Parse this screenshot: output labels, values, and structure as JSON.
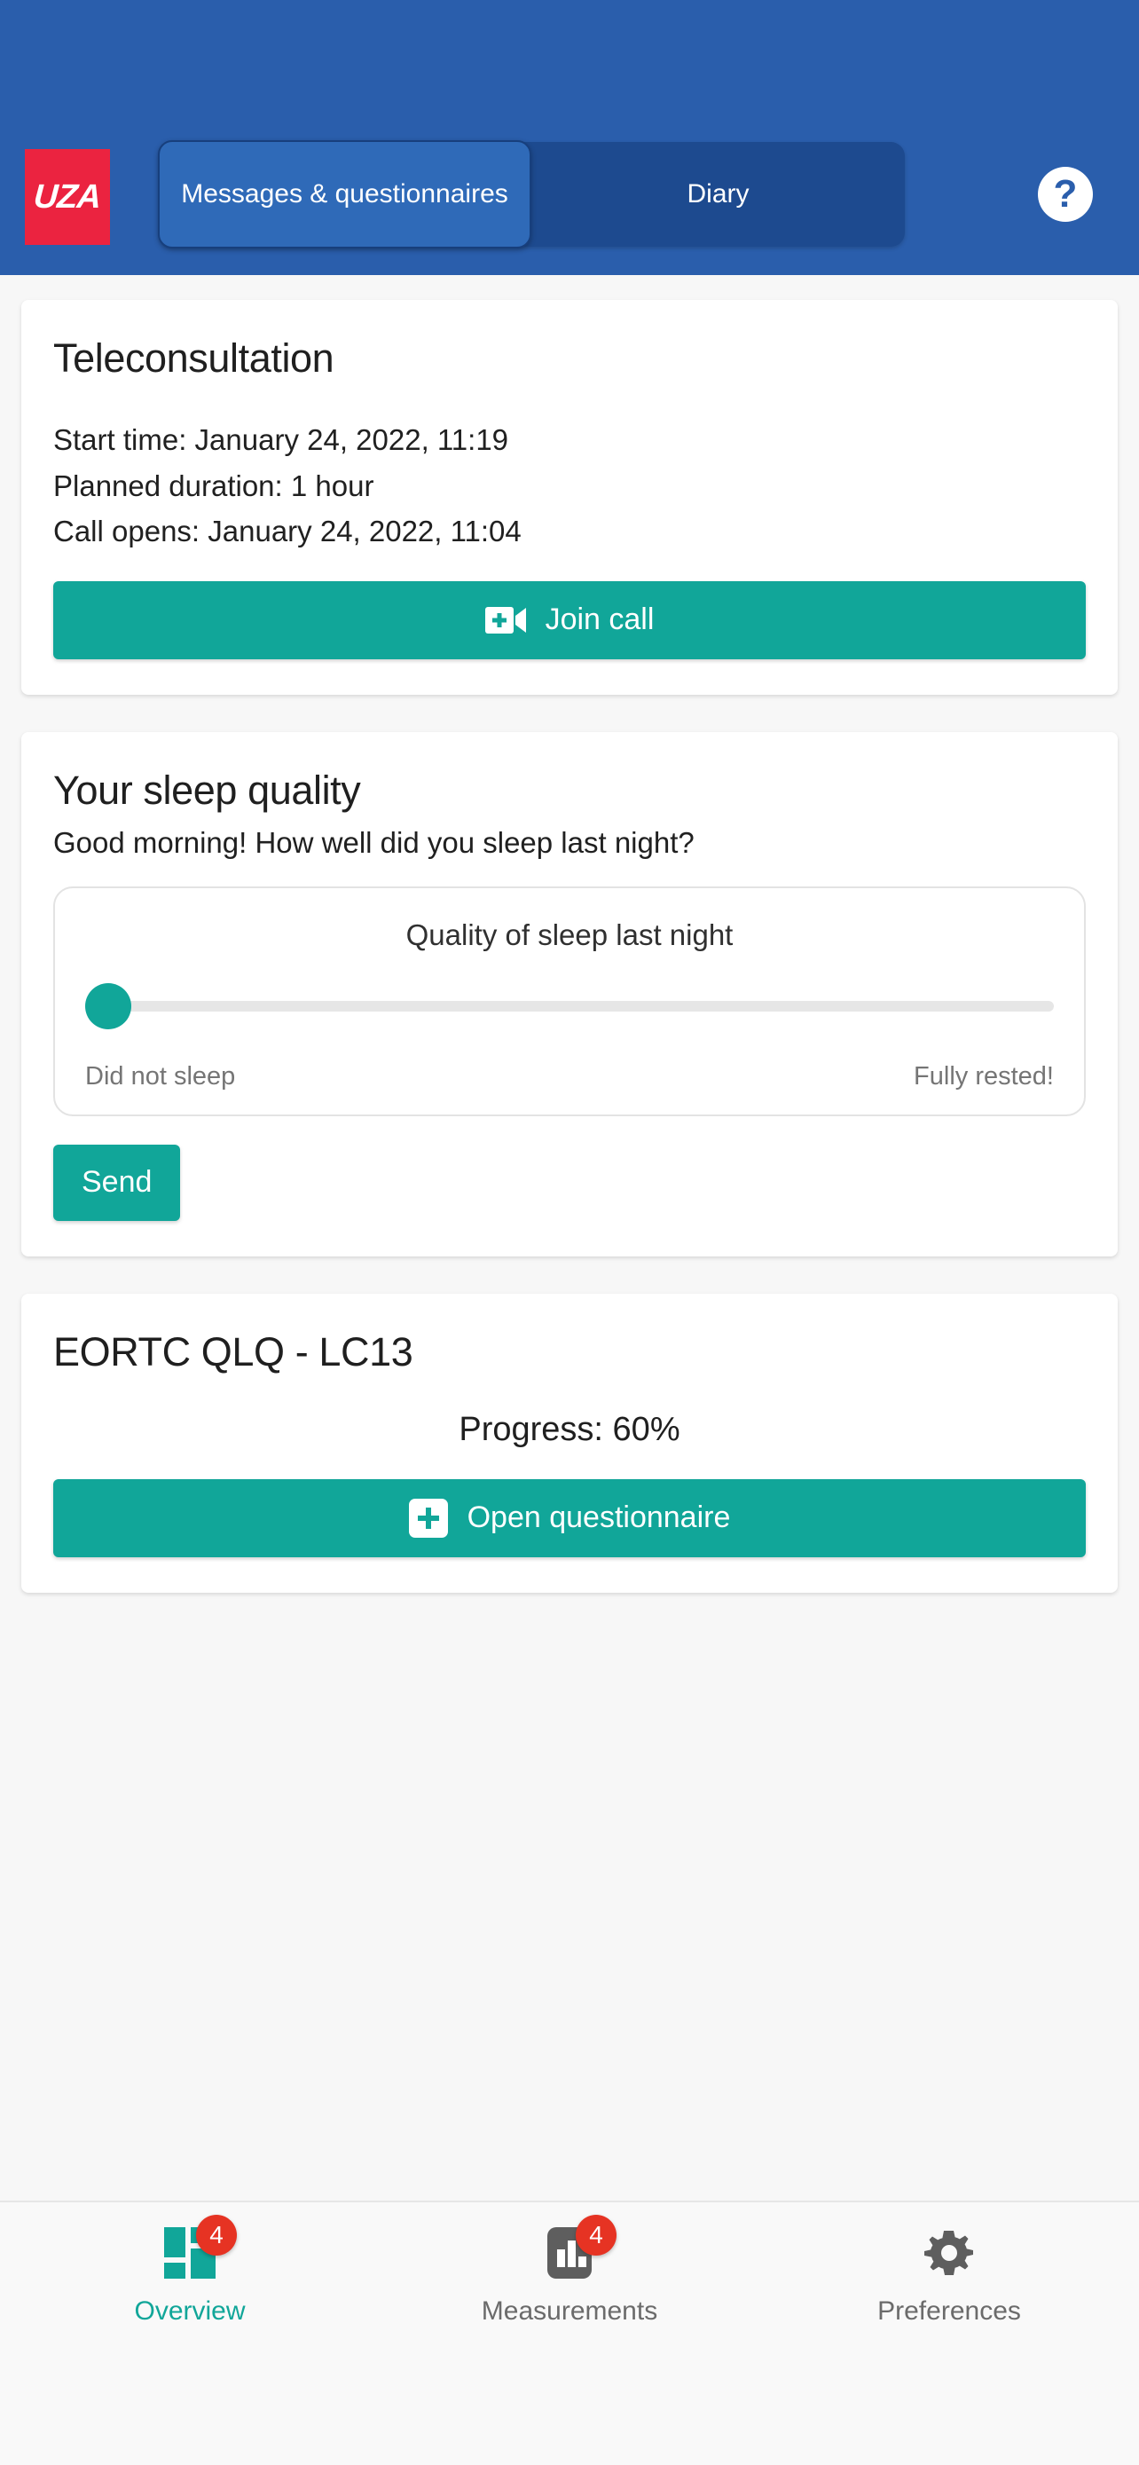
{
  "brand": {
    "logo_text": "UZA",
    "logo_bg": "#eb2340",
    "header_bg": "#2a5eac",
    "accent": "#11a699",
    "badge_color": "#e63323"
  },
  "header": {
    "tabs": [
      {
        "label": "Messages & questionnaires",
        "active": true
      },
      {
        "label": "Diary",
        "active": false
      }
    ],
    "help_icon": "question-mark-icon",
    "help_glyph": "?"
  },
  "cards": {
    "teleconsultation": {
      "title": "Teleconsultation",
      "start_time": "Start time: January 24, 2022, 11:19",
      "planned_duration": "Planned duration: 1 hour",
      "call_opens": "Call opens: January 24, 2022, 11:04",
      "join_button": "Join call",
      "join_icon": "video-call-add-icon"
    },
    "sleep": {
      "title": "Your sleep quality",
      "question": "Good morning! How well did you sleep last night?",
      "slider_caption": "Quality of sleep last night",
      "slider_min_label": "Did not sleep",
      "slider_max_label": "Fully rested!",
      "slider_value": 0,
      "slider_min": 0,
      "slider_max": 100,
      "send_button": "Send"
    },
    "questionnaire": {
      "title": "EORTC QLQ - LC13",
      "progress_text": "Progress: 60%",
      "progress_value": 60,
      "open_button": "Open questionnaire",
      "open_icon": "plus-box-icon"
    }
  },
  "bottom_nav": {
    "items": [
      {
        "label": "Overview",
        "icon": "dashboard-icon",
        "badge": "4",
        "active": true
      },
      {
        "label": "Measurements",
        "icon": "bar-chart-icon",
        "badge": "4",
        "active": false
      },
      {
        "label": "Preferences",
        "icon": "gear-icon",
        "badge": "",
        "active": false
      }
    ]
  }
}
